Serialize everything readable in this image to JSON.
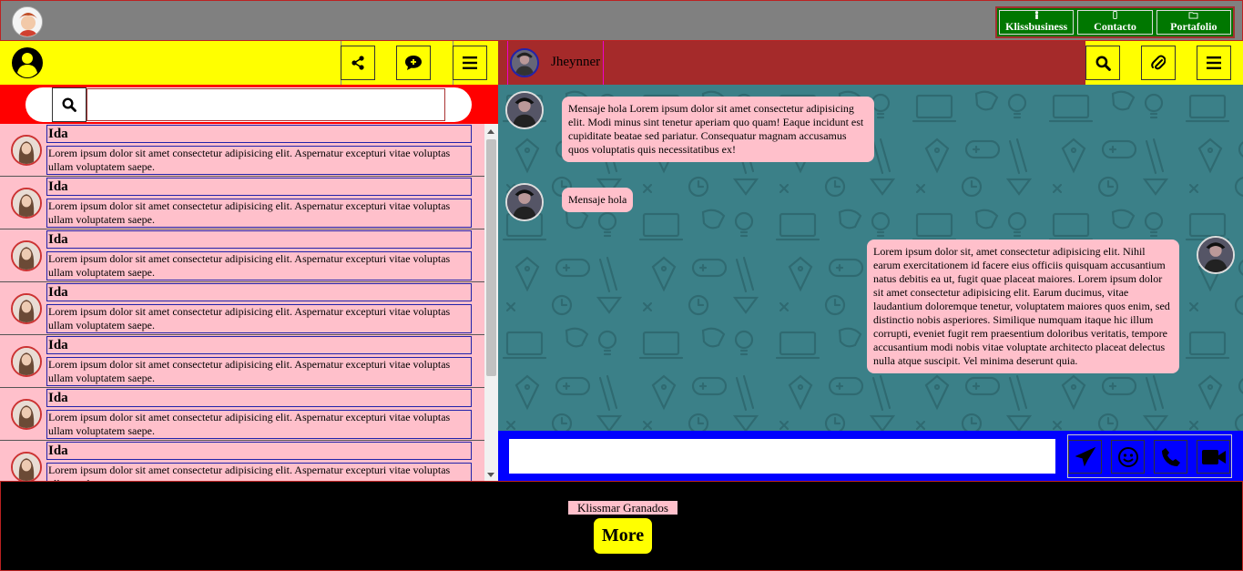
{
  "topbar": {
    "nav": [
      {
        "label": "Klissbusiness",
        "icon": "person-icon"
      },
      {
        "label": "Contacto",
        "icon": "phone-icon"
      },
      {
        "label": "Portafolio",
        "icon": "folder-icon"
      }
    ]
  },
  "search": {
    "placeholder": ""
  },
  "chats": [
    {
      "name": "Ida",
      "preview": "Lorem ipsum dolor sit amet consectetur adipisicing elit. Aspernatur excepturi vitae voluptas ullam voluptatem saepe."
    },
    {
      "name": "Ida",
      "preview": "Lorem ipsum dolor sit amet consectetur adipisicing elit. Aspernatur excepturi vitae voluptas ullam voluptatem saepe."
    },
    {
      "name": "Ida",
      "preview": "Lorem ipsum dolor sit amet consectetur adipisicing elit. Aspernatur excepturi vitae voluptas ullam voluptatem saepe."
    },
    {
      "name": "Ida",
      "preview": "Lorem ipsum dolor sit amet consectetur adipisicing elit. Aspernatur excepturi vitae voluptas ullam voluptatem saepe."
    },
    {
      "name": "Ida",
      "preview": "Lorem ipsum dolor sit amet consectetur adipisicing elit. Aspernatur excepturi vitae voluptas ullam voluptatem saepe."
    },
    {
      "name": "Ida",
      "preview": "Lorem ipsum dolor sit amet consectetur adipisicing elit. Aspernatur excepturi vitae voluptas ullam voluptatem saepe."
    },
    {
      "name": "Ida",
      "preview": "Lorem ipsum dolor sit amet consectetur adipisicing elit. Aspernatur excepturi vitae voluptas ullam voluptatem saepe."
    }
  ],
  "contact": {
    "name": "Jheynner"
  },
  "messages": [
    {
      "text": "Mensaje hola Lorem ipsum dolor sit amet consectetur adipisicing elit. Modi minus sint tenetur aperiam quo quam! Eaque incidunt est cupiditate beatae sed pariatur. Consequatur magnam accusamus quos voluptatis quis necessitatibus ex!"
    },
    {
      "text": "Mensaje hola"
    },
    {
      "text": "Lorem ipsum dolor sit, amet consectetur adipisicing elit. Nihil earum exercitationem id facere eius officiis quisquam accusantium natus debitis ea ut, fugit quae placeat maiores. Lorem ipsum dolor sit amet consectetur adipisicing elit. Earum ducimus, vitae laudantium doloremque tenetur, voluptatem maiores quos enim, sed distinctio nobis asperiores. Similique numquam itaque hic illum corrupti, eveniet fugit rem praesentium doloribus veritatis, tempore accusantium modi nobis vitae voluptate architecto placeat delectus nulla atque suscipit. Vel minima deserunt quia."
    }
  ],
  "composer": {
    "placeholder": ""
  },
  "footer": {
    "author": "Klissmar Granados",
    "more_label": "More"
  },
  "colors": {
    "topbar": "#808080",
    "left_header": "#ffff00",
    "search_bar": "#ff0000",
    "list_item": "#ffc0cb",
    "right_header": "#a52a2a",
    "chat_bg": "#3b8088",
    "composer_bar": "#0000ff",
    "nav_green": "#007700"
  }
}
